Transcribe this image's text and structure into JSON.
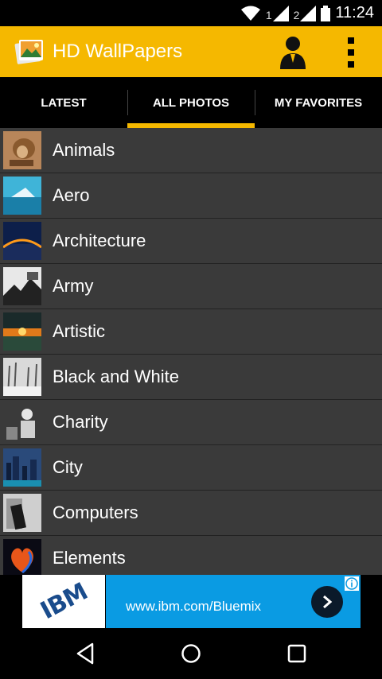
{
  "status_bar": {
    "sim1_label": "1",
    "sim2_label": "2",
    "time": "11:24"
  },
  "app_bar": {
    "title": "HD WallPapers",
    "icons": [
      "gallery-logo-icon",
      "user-icon",
      "overflow-menu-icon"
    ]
  },
  "tabs": [
    {
      "label": "LATEST",
      "active": false
    },
    {
      "label": "ALL PHOTOS",
      "active": true
    },
    {
      "label": "MY FAVORITES",
      "active": false
    }
  ],
  "categories": [
    {
      "label": "Animals"
    },
    {
      "label": "Aero"
    },
    {
      "label": "Architecture"
    },
    {
      "label": "Army"
    },
    {
      "label": "Artistic"
    },
    {
      "label": "Black and White"
    },
    {
      "label": "Charity"
    },
    {
      "label": "City"
    },
    {
      "label": "Computers"
    },
    {
      "label": "Elements"
    }
  ],
  "ad": {
    "logo_text": "IBM",
    "url": "www.ibm.com/Bluemix"
  },
  "colors": {
    "accent": "#f5b800",
    "background": "#3a3a3a",
    "ad_blue": "#0a9be3"
  }
}
